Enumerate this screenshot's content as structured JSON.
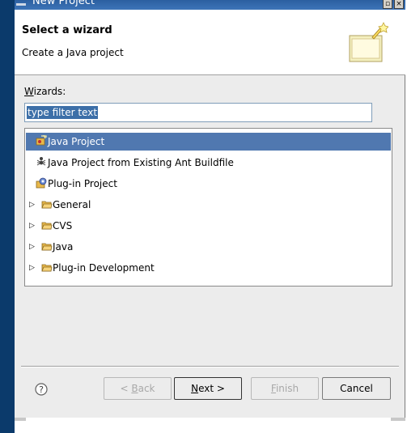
{
  "window": {
    "title": "New Project"
  },
  "header": {
    "title": "Select a wizard",
    "description": "Create a Java project"
  },
  "wizards": {
    "label_mnemonic": "W",
    "label_rest": "izards:",
    "filter_text": "type filter text"
  },
  "tree": [
    {
      "label": "Java Project",
      "icon": "java-project-icon",
      "expandable": false,
      "selected": true
    },
    {
      "label": "Java Project from Existing Ant Buildfile",
      "icon": "ant-icon",
      "expandable": false,
      "selected": false
    },
    {
      "label": "Plug-in Project",
      "icon": "plugin-project-icon",
      "expandable": false,
      "selected": false
    },
    {
      "label": "General",
      "icon": "folder-icon",
      "expandable": true,
      "selected": false
    },
    {
      "label": "CVS",
      "icon": "folder-icon",
      "expandable": true,
      "selected": false
    },
    {
      "label": "Java",
      "icon": "folder-icon",
      "expandable": true,
      "selected": false
    },
    {
      "label": "Plug-in Development",
      "icon": "folder-icon",
      "expandable": true,
      "selected": false
    }
  ],
  "buttons": {
    "back": {
      "prefix": "< ",
      "mnemonic": "B",
      "rest": "ack"
    },
    "next": {
      "mnemonic": "N",
      "rest": "ext >"
    },
    "finish": {
      "mnemonic": "F",
      "rest": "inish"
    },
    "cancel": "Cancel"
  },
  "colors": {
    "selection": "#5078b0",
    "title_bar": "#2b5fa0",
    "desktop": "#0b3a6b",
    "folder": "#e8b84a"
  }
}
